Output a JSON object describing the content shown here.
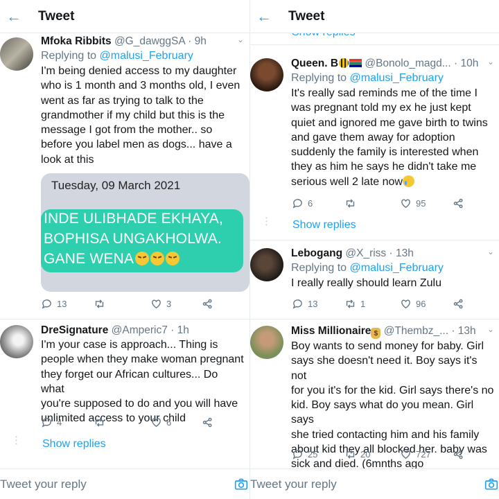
{
  "left": {
    "title": "Tweet",
    "tweets": [
      {
        "name": "Mfoka Ribbits",
        "handle": "@G_dawggSA",
        "time": "· 9h",
        "replying_prefix": "Replying to ",
        "replying_mention": "@malusi_February",
        "text_lines": [
          "I'm being denied access to my daughter",
          "who is 1 month and 3 months old, I even",
          "went as far as trying to talk to the",
          "grandmother if my child but this is the",
          "message I got from the mother.. so",
          "before you label men as dogs... have a",
          "look at this"
        ],
        "media": {
          "date": "Tuesday, 09 March 2021",
          "lines": [
            "INDE ULIBHADE EKHAYA,",
            "BOPHISA UNGAKHOLWA.",
            "GANE WENA"
          ]
        },
        "replies": "13",
        "retweets": "",
        "likes": "3"
      },
      {
        "name": "DreSignature",
        "handle": "@Amperic7",
        "time": "· 1h",
        "text_lines": [
          "I'm your case is approach... Thing is",
          "people when they make woman pregnant",
          "they forget our African cultures... Do what",
          "you're supposed to do and you will have",
          "unlimited access to your child"
        ],
        "replies": "4",
        "retweets": "",
        "likes": "6",
        "show_replies": "Show replies"
      }
    ],
    "reply_placeholder": "Tweet your reply"
  },
  "right": {
    "title": "Tweet",
    "top_cut_text": "Show replies",
    "tweets": [
      {
        "name": "Queen. B",
        "handle": "@Bonolo_magd...",
        "time": "· 10h",
        "replying_prefix": "Replying to ",
        "replying_mention": "@malusi_February",
        "text_lines": [
          "It's really sad reminds me of the time I",
          "was pregnant told my ex he just kept",
          "quiet and ignored me gave birth to twins",
          "and gave them away for adoption",
          "suddenly the family is interested when",
          "they as him he says he didn't take me",
          "serious well 2 late now"
        ],
        "replies": "6",
        "retweets": "",
        "likes": "95",
        "show_replies": "Show replies"
      },
      {
        "name": "Lebogang",
        "handle": "@X_riss",
        "time": "· 13h",
        "replying_prefix": "Replying to ",
        "replying_mention": "@malusi_February",
        "text_lines": [
          "I really really should learn Zulu"
        ],
        "replies": "13",
        "retweets": "1",
        "likes": "96"
      },
      {
        "name": "Miss Millionaire",
        "handle": "@Thembz_...",
        "time": "· 13h",
        "text_lines": [
          "Boy wants to send money for baby. Girl",
          "says she doesn't need it. Boy says it's not",
          "for you it's for the kid. Girl says there's no",
          "kid. Boy says what do you mean. Girl says",
          "she tried contacting him and his family",
          "about kid they all blocked her.  baby was",
          "sick and died. (6mnths ago"
        ],
        "replies": "25",
        "retweets": "20",
        "likes": "727"
      }
    ],
    "reply_placeholder": "Tweet your reply"
  },
  "colors": {
    "accent": "#1da1f2",
    "muted": "#657786",
    "bubble": "#2ecfae"
  }
}
